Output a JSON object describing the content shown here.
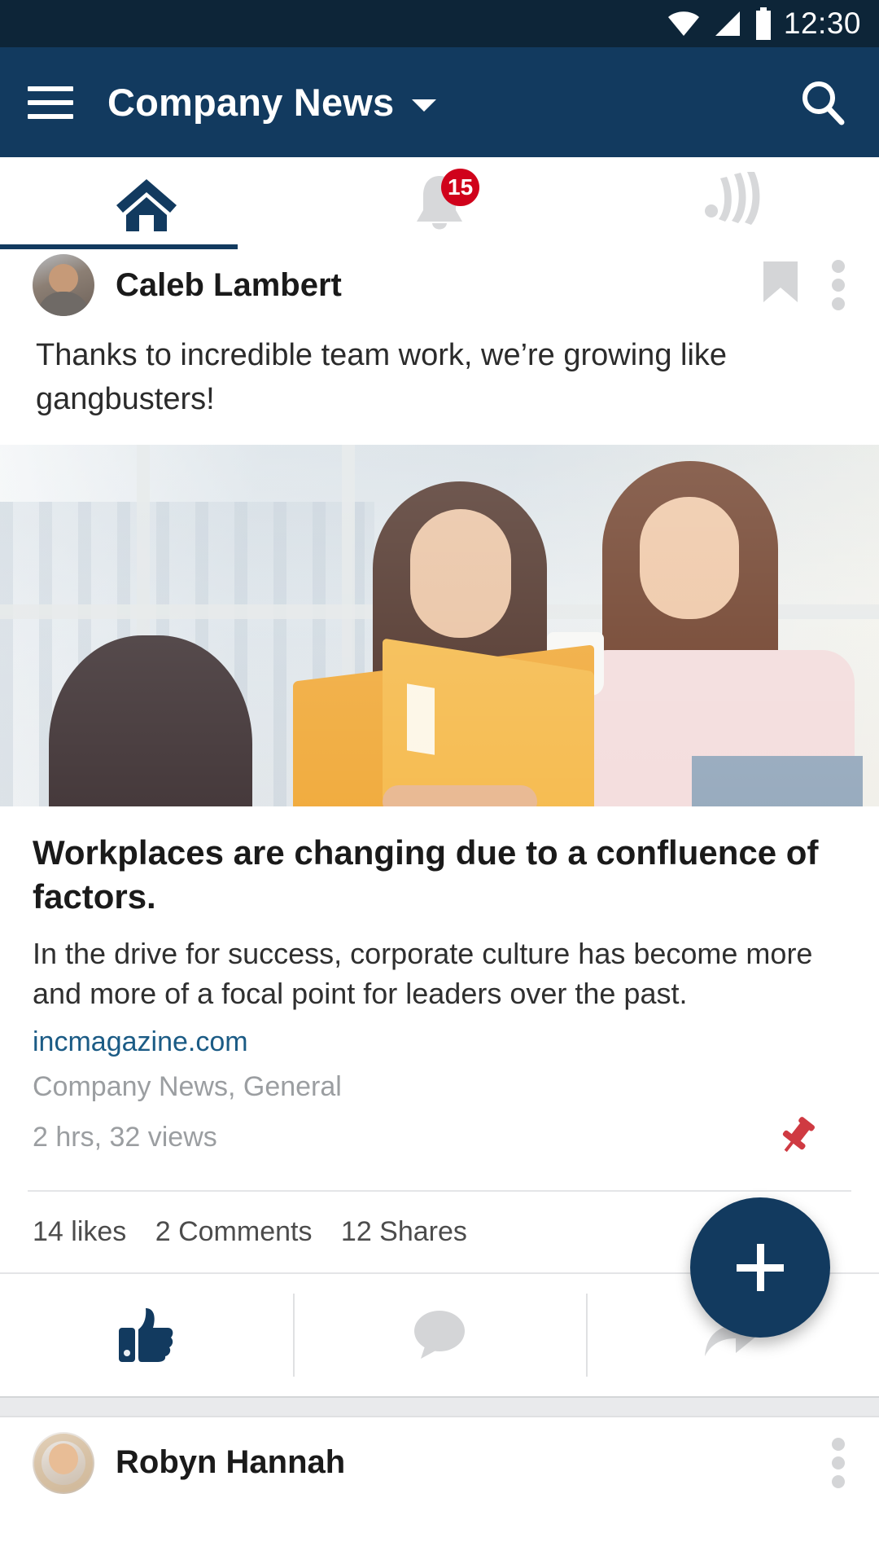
{
  "status_bar": {
    "time": "12:30",
    "icons": [
      "wifi-icon",
      "cellular-signal-icon",
      "battery-icon"
    ]
  },
  "app_bar": {
    "menu_icon": "hamburger-menu-icon",
    "title": "Company News",
    "dropdown_icon": "chevron-down-icon",
    "search_icon": "search-icon"
  },
  "tabs": [
    {
      "name": "home",
      "icon": "home-icon",
      "active": true,
      "badge": ""
    },
    {
      "name": "notifications",
      "icon": "bell-icon",
      "active": false,
      "badge": "15"
    },
    {
      "name": "broadcast",
      "icon": "broadcast-icon",
      "active": false,
      "badge": ""
    }
  ],
  "posts": [
    {
      "author": "Caleb Lambert",
      "bookmark_icon": "bookmark-icon",
      "overflow_icon": "more-vertical-icon",
      "body": "Thanks to incredible team work, we’re growing like gangbusters!",
      "article": {
        "title": "Workplaces are changing due to a confluence of factors.",
        "description": "In the drive for success, corporate culture has become more and more of a focal point for leaders over the past.",
        "link": "incmagazine.com",
        "categories": "Company News, General",
        "meta": "2 hrs, 32 views",
        "pin_icon": "pushpin-icon"
      },
      "counts": {
        "likes": "14 likes",
        "comments": "2 Comments",
        "shares": "12 Shares"
      },
      "actions": [
        {
          "name": "like",
          "icon": "thumbs-up-icon",
          "state": "active"
        },
        {
          "name": "comment",
          "icon": "comment-bubble-icon",
          "state": "inactive"
        },
        {
          "name": "share",
          "icon": "share-arrow-icon",
          "state": "inactive"
        }
      ]
    },
    {
      "author": "Robyn Hannah",
      "overflow_icon": "more-vertical-icon"
    }
  ],
  "fab": {
    "icon": "plus-icon",
    "label": "+"
  },
  "colors": {
    "status_bar": "#0d2538",
    "app_bar": "#123a5f",
    "accent": "#123a5f",
    "badge": "#d0021b",
    "link": "#1b5b85",
    "pin": "#cf3a42",
    "muted_text": "#9b9ea1"
  }
}
